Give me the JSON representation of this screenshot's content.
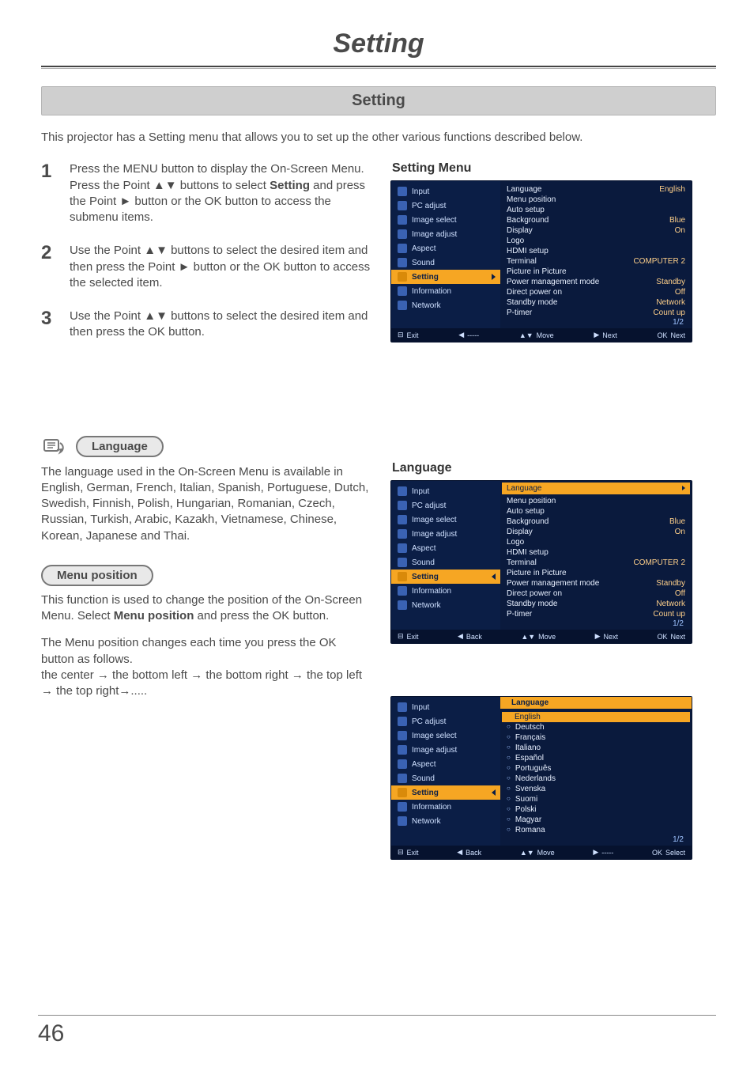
{
  "page": {
    "title": "Setting",
    "section_bar": "Setting",
    "intro": "This projector has a Setting menu that allows you to set up the other various functions described below.",
    "number": "46"
  },
  "steps": {
    "s1": {
      "num": "1",
      "text_a": "Press the MENU button to display the On-Screen Menu. Press the Point ▲▼ buttons to select ",
      "bold": "Setting",
      "text_b": " and press the Point ► button or the OK button to access the submenu items."
    },
    "s2": {
      "num": "2",
      "text": "Use the Point ▲▼ buttons to select the desired item and then press the Point ► button or the OK button to access the selected item."
    },
    "s3": {
      "num": "3",
      "text": "Use the Point ▲▼ buttons to select the desired item and then press the OK button."
    }
  },
  "labels": {
    "setting_menu": "Setting Menu",
    "language_pill": "Language",
    "language_heading": "Language",
    "menu_position_pill": "Menu position"
  },
  "lang_para": "The language used in the On-Screen Menu is available in English, German, French, Italian, Spanish, Portuguese, Dutch, Swedish, Finnish, Polish, Hungarian, Romanian, Czech, Russian, Turkish, Arabic, Kazakh, Vietnamese, Chinese, Korean, Japanese and Thai.",
  "menu_pos": {
    "p1a": "This function is used to change the position of the On-Screen Menu. Select ",
    "p1bold": "Menu position",
    "p1b": " and press the OK button.",
    "p2": "The Menu position changes each time you press the OK button as follows.",
    "p3": "the center → the bottom left → the bottom right → the top left → the top right→....."
  },
  "osd": {
    "menu_items": {
      "m0": "Input",
      "m1": "PC adjust",
      "m2": "Image select",
      "m3": "Image adjust",
      "m4": "Aspect",
      "m5": "Sound",
      "m6": "Setting",
      "m7": "Information",
      "m8": "Network"
    },
    "panel_rows": {
      "r0k": "Language",
      "r0v": "English",
      "r1k": "Menu position",
      "r2k": "Auto setup",
      "r3k": "Background",
      "r3v": "Blue",
      "r4k": "Display",
      "r4v": "On",
      "r5k": "Logo",
      "r6k": "HDMI setup",
      "r7k": "Terminal",
      "r7v": "COMPUTER 2",
      "r8k": "Picture in Picture",
      "r9k": "Power management mode",
      "r9v": "Standby",
      "r10k": "Direct power on",
      "r10v": "Off",
      "r11k": "Standby mode",
      "r11v": "Network",
      "r12k": "P-timer",
      "r12v": "Count up",
      "pager": "1/2"
    },
    "footer": {
      "exit": "Exit",
      "back": "Back",
      "dash": "-----",
      "move": "Move",
      "next": "Next",
      "select": "Select",
      "ok_next": "Next"
    },
    "lang_panel_title": "Language",
    "langs": {
      "l0": "English",
      "l1": "Deutsch",
      "l2": "Français",
      "l3": "Italiano",
      "l4": "Español",
      "l5": "Português",
      "l6": "Nederlands",
      "l7": "Svenska",
      "l8": "Suomi",
      "l9": "Polski",
      "l10": "Magyar",
      "l11": "Romana"
    }
  }
}
